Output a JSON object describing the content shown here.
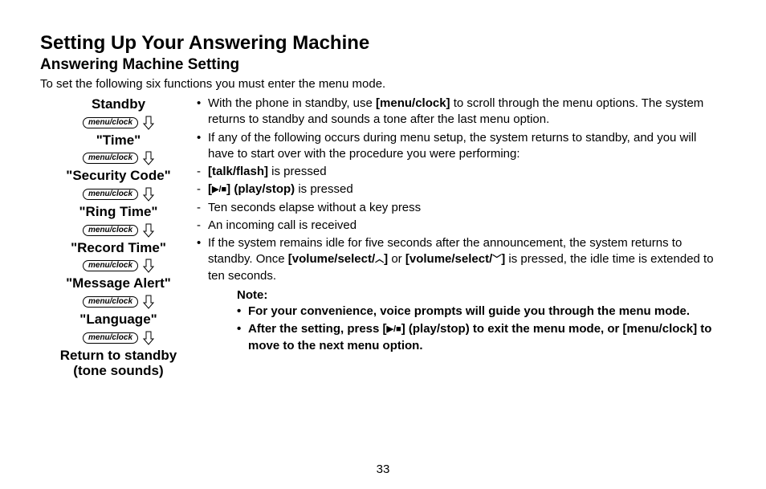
{
  "title": "Setting Up Your Answering Machine",
  "subtitle": "Answering Machine Setting",
  "intro": "To set the following six functions you must enter the menu mode.",
  "flow": {
    "button_label": "menu/clock",
    "steps": [
      "Standby",
      "\"Time\"",
      "\"Security Code\"",
      "\"Ring Time\"",
      "\"Record Time\"",
      "\"Message Alert\"",
      "\"Language\""
    ],
    "final_line1": "Return to standby",
    "final_line2": "(tone sounds)"
  },
  "body": {
    "b1_pre": "With the phone in standby, use ",
    "b1_key": "[menu/clock]",
    "b1_post": " to scroll through the menu options. The system returns to standby and sounds a tone after the last menu option.",
    "b2": "If any of the following occurs during menu setup, the system returns to standby, and you will have to start over with the procedure you were performing:",
    "d1_key": "[talk/flash]",
    "d1_post": " is pressed",
    "d2_key_open": "[",
    "d2_key_close": "] (play/stop)",
    "d2_post": " is pressed",
    "d3": "Ten seconds elapse without a key press",
    "d4": "An incoming call is received",
    "b3_pre": "If the system remains idle for five seconds after the announcement, the system returns to standby. Once ",
    "b3_key1_open": "[volume/select/",
    "b3_key1_close": "]",
    "b3_mid": " or ",
    "b3_key2_open": "[volume/select/",
    "b3_key2_close": "]",
    "b3_post": " is pressed, the idle time is extended to ten seconds."
  },
  "note": {
    "title": "Note:",
    "n1": "For your convenience, voice prompts will guide you through the menu mode.",
    "n2_pre": "After the setting, press [",
    "n2_post": "] (play/stop) to exit the menu mode, or [menu/clock] to move to the next menu option."
  },
  "page_number": "33"
}
